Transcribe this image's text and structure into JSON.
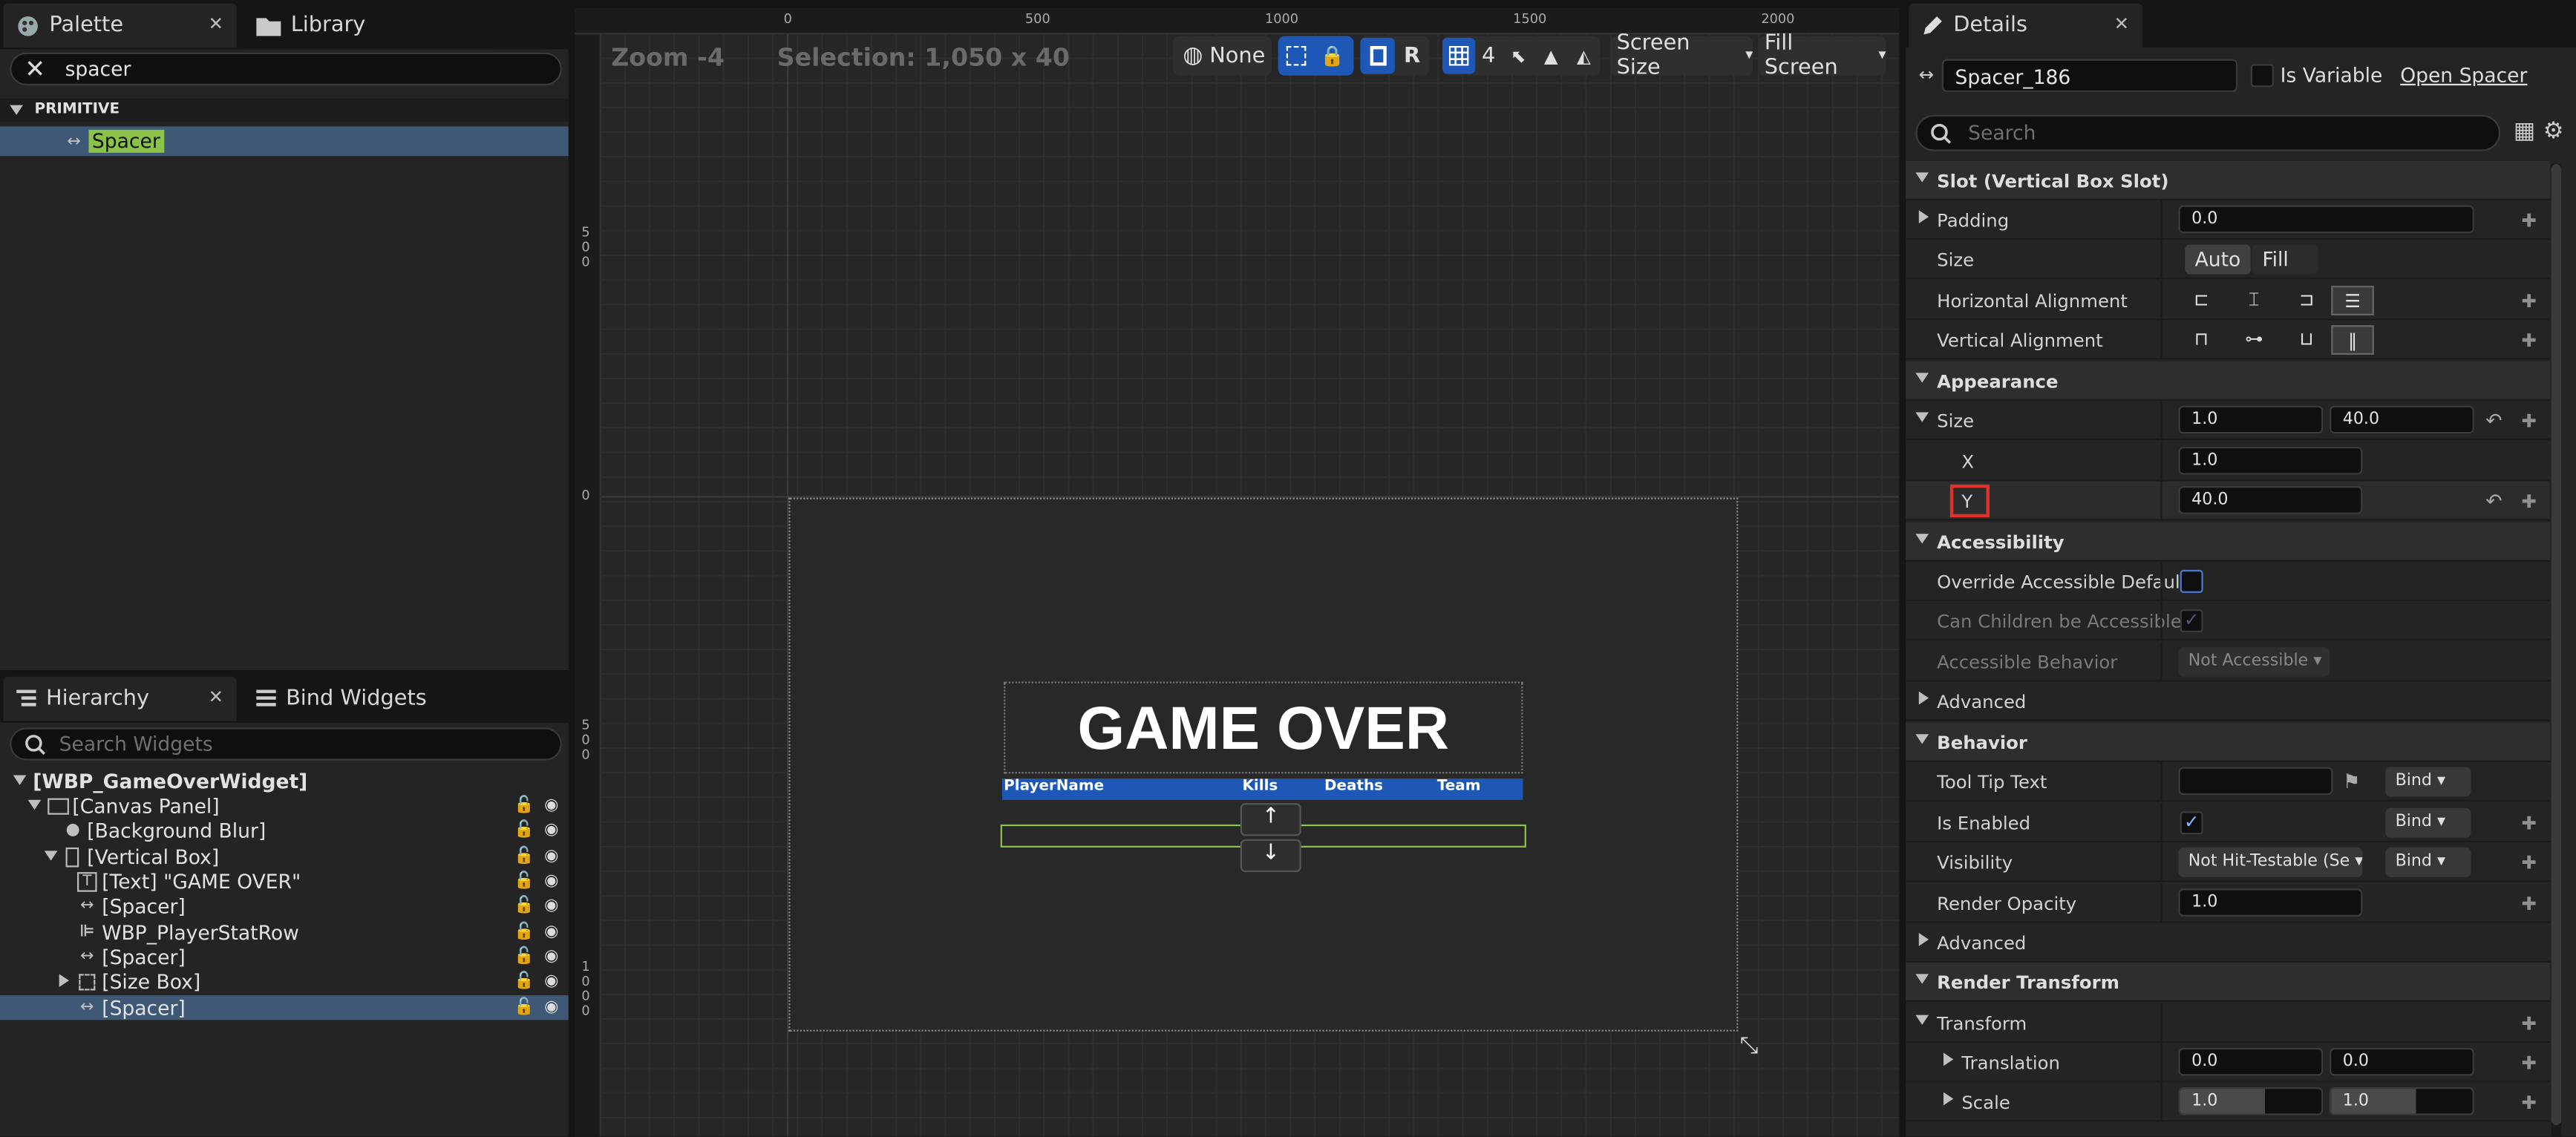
{
  "palette": {
    "tab_label": "Palette",
    "library_tab_label": "Library",
    "search_value": "spacer",
    "category": "PRIMITIVE",
    "item_label": "Spacer"
  },
  "hierarchy": {
    "tab_label": "Hierarchy",
    "bind_tab_label": "Bind Widgets",
    "search_placeholder": "Search Widgets",
    "items": [
      {
        "label": "[WBP_GameOverWidget]",
        "icon": "none"
      },
      {
        "label": "[Canvas Panel]",
        "icon": "canvas-panel-icon"
      },
      {
        "label": "[Background Blur]",
        "icon": "dot-icon"
      },
      {
        "label": "[Vertical Box]",
        "icon": "vertical-box-icon"
      },
      {
        "label": "[Text] \"GAME OVER\"",
        "icon": "text-icon"
      },
      {
        "label": "[Spacer]",
        "icon": "spacer-icon"
      },
      {
        "label": "WBP_PlayerStatRow",
        "icon": "user-widget-icon"
      },
      {
        "label": "[Spacer]",
        "icon": "spacer-icon"
      },
      {
        "label": "[Size Box]",
        "icon": "size-box-icon"
      },
      {
        "label": "[Spacer]",
        "icon": "spacer-icon"
      }
    ]
  },
  "viewport": {
    "zoom": "Zoom -4",
    "selection": "Selection: 1,050 x 40",
    "none_label": "None",
    "r_label": "R",
    "grid_value": "4",
    "screen_size": "Screen Size",
    "fill_screen": "Fill Screen",
    "ruler_h": [
      "0",
      "500",
      "1000",
      "1500",
      "2000"
    ],
    "ruler_v": [
      "500",
      "0",
      "500",
      "1000"
    ],
    "game_over": "GAME OVER",
    "table_headers": [
      "PlayerName",
      "Kills",
      "Deaths",
      "Team"
    ],
    "up_arrow": "↑",
    "down_arrow": "↓"
  },
  "details": {
    "tab_label": "Details",
    "widget_name": "Spacer_186",
    "is_variable": "Is Variable",
    "open_spacer": "Open Spacer",
    "search_placeholder": "Search",
    "slot_cat": "Slot (Vertical Box Slot)",
    "padding": "Padding",
    "padding_value": "0.0",
    "size": "Size",
    "auto": "Auto",
    "fill": "Fill",
    "h_align": "Horizontal Alignment",
    "v_align": "Vertical Alignment",
    "appearance_cat": "Appearance",
    "size_x_val": "1.0",
    "size_y_val": "40.0",
    "x_label": "X",
    "y_label": "Y",
    "accessibility_cat": "Accessibility",
    "override": "Override Accessible Defaults",
    "children": "Can Children be Accessible",
    "behavior_label": "Accessible Behavior",
    "not_accessible": "Not Accessible",
    "advanced": "Advanced",
    "behavior_cat": "Behavior",
    "tooltip": "Tool Tip Text",
    "bind": "Bind",
    "is_enabled": "Is Enabled",
    "visibility": "Visibility",
    "visibility_value": "Not Hit-Testable (Se",
    "render_opacity": "Render Opacity",
    "opacity_value": "1.0",
    "render_transform_cat": "Render Transform",
    "transform": "Transform",
    "translation": "Translation",
    "trans_x": "0.0",
    "trans_y": "0.0",
    "scale": "Scale",
    "scale_x": "1.0",
    "scale_y": "1.0"
  },
  "colors": {
    "accent": "#1d58b7",
    "selection": "#3e5875",
    "highlight": "#8bc34a",
    "panel": "#242424"
  }
}
